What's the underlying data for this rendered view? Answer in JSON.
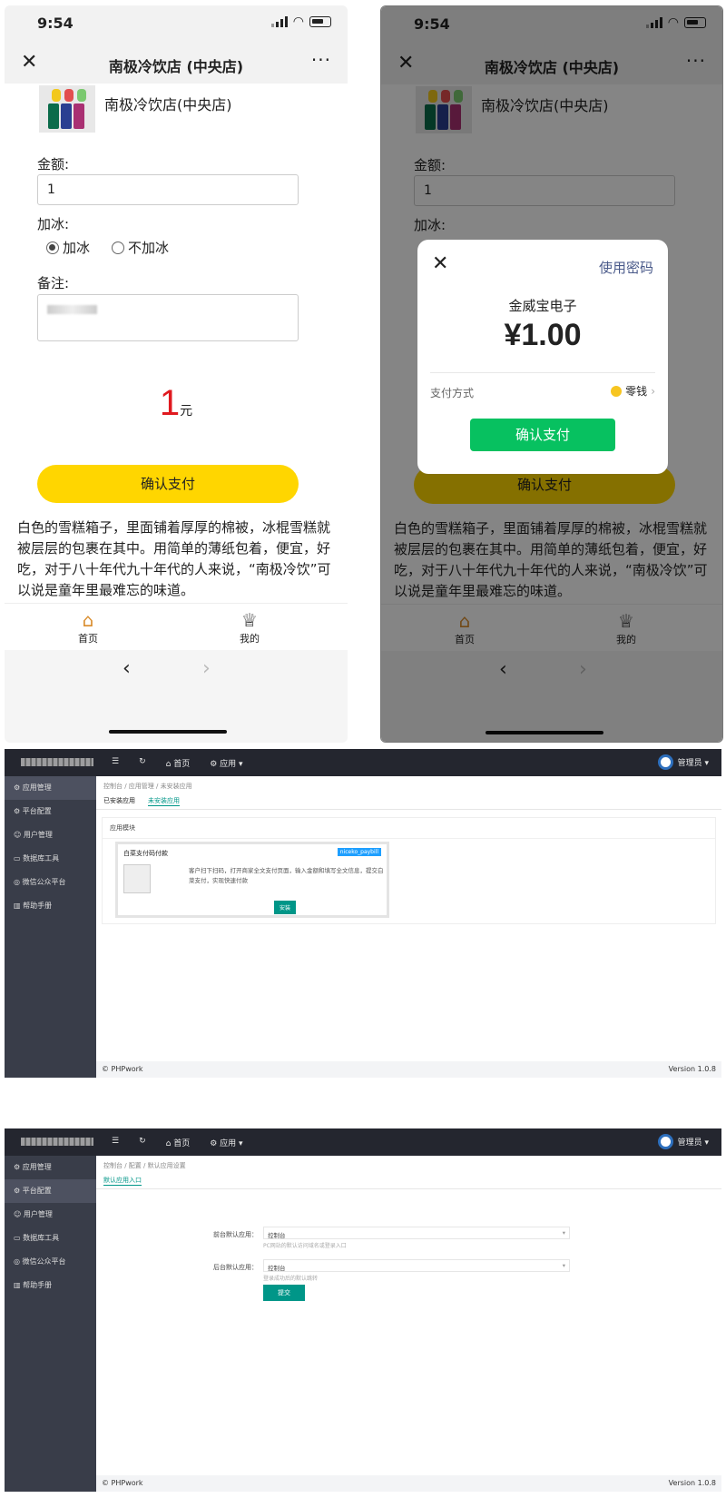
{
  "phone": {
    "time": "9:54",
    "nav_title": "南极冷饮店 (中央店)",
    "shop_name": "南极冷饮店(中央店)",
    "amount_label": "金额:",
    "amount_value": "1",
    "ice_label": "加冰:",
    "ice_options": [
      "加冰",
      "不加冰"
    ],
    "ice_selected": "加冰",
    "note_label": "备注:",
    "price_value": "1",
    "price_unit": "元",
    "pay_button": "确认支付",
    "description": "白色的雪糕箱子，里面铺着厚厚的棉被，冰棍雪糕就被层层的包裹在其中。用简单的薄纸包着，便宜，好吃，对于八十年代九十年代的人来说，“南极冷饮”可以说是童年里最难忘的味道。",
    "tabs": [
      {
        "label": "首页",
        "icon": "home-icon"
      },
      {
        "label": "我的",
        "icon": "crown-icon"
      }
    ],
    "pay_button_color": "#ffd600",
    "price_color": "#e0191f"
  },
  "payment_modal": {
    "use_password": "使用密码",
    "merchant": "金威宝电子",
    "amount": "¥1.00",
    "method_label": "支付方式",
    "method_value": "零钱",
    "confirm": "确认支付",
    "confirm_color": "#07c160"
  },
  "admin": {
    "topbar_items": [
      "☰",
      "↻",
      "⌂ 首页",
      "⚙ 应用 ▾"
    ],
    "user": "管理员 ▾",
    "sidebar": [
      "应用管理",
      "平台配置",
      "用户管理",
      "数据库工具",
      "微信公众平台",
      "帮助手册"
    ],
    "footer_left": "© PHPwork",
    "footer_right": "Version 1.0.8",
    "screen1": {
      "breadcrumb": "控制台 / 应用管理 / 未安装应用",
      "tabs": [
        "已安装应用",
        "未安装应用"
      ],
      "panel_title": "应用模块",
      "card_title": "白菜支付码付款",
      "card_tag": "niceko_paybill",
      "card_desc": "客户扫下扫码，打开商家全文支付页面，输入金额和填写全文信息，提交白菜支付，实现快速付款",
      "card_button": "安装"
    },
    "screen2": {
      "breadcrumb": "控制台 / 配置 / 默认应用设置",
      "tab": "默认应用入口",
      "front_label": "前台默认应用：",
      "front_value": "控制台",
      "front_hint": "PC网站的默认访问域名或登录入口",
      "back_label": "后台默认应用：",
      "back_value": "控制台",
      "back_hint": "登录成功后的默认跳转",
      "submit": "提交"
    }
  }
}
